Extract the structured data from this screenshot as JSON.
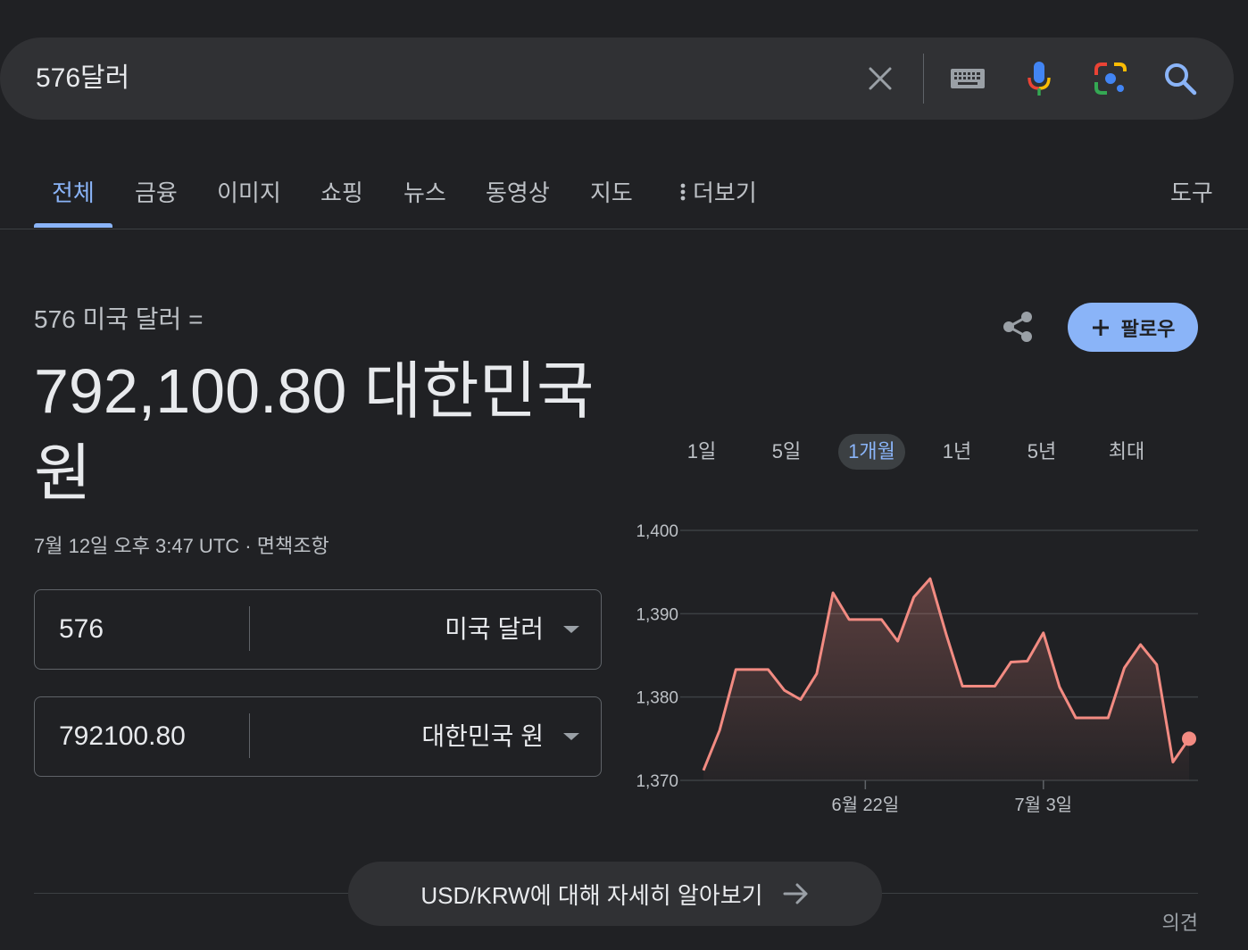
{
  "search": {
    "query": "576달러"
  },
  "icons": {
    "clear": "close-icon",
    "keyboard": "keyboard-icon",
    "mic": "microphone-icon",
    "lens": "google-lens-icon",
    "search": "search-icon",
    "share": "share-icon",
    "more": "more-vert-icon",
    "arrow": "arrow-right-icon"
  },
  "tabs": [
    {
      "label": "전체",
      "active": true
    },
    {
      "label": "금융"
    },
    {
      "label": "이미지"
    },
    {
      "label": "쇼핑"
    },
    {
      "label": "뉴스"
    },
    {
      "label": "동영상"
    },
    {
      "label": "지도"
    },
    {
      "label": "더보기"
    }
  ],
  "tools_label": "도구",
  "result": {
    "from_label": "576 미국 달러 =",
    "amount": "792,100.80 대한민국",
    "amount_unit": "원",
    "timestamp": "7월 12일 오후 3:47 UTC",
    "separator": "·",
    "disclaimer": "면책조항"
  },
  "converter": {
    "from": {
      "value": "576",
      "currency": "미국 달러"
    },
    "to": {
      "value": "792100.80",
      "currency": "대한민국 원"
    }
  },
  "follow_label": "팔로우",
  "ranges": [
    {
      "label": "1일"
    },
    {
      "label": "5일"
    },
    {
      "label": "1개월",
      "active": true
    },
    {
      "label": "1년"
    },
    {
      "label": "5년"
    },
    {
      "label": "최대"
    }
  ],
  "colors": {
    "accent": "#8ab4f8",
    "line": "#f28b82",
    "background": "#202124"
  },
  "chart_data": {
    "type": "area",
    "ylim": [
      1370,
      1400
    ],
    "yticks": [
      "1,400",
      "1,390",
      "1,380",
      "1,370"
    ],
    "ytick_values": [
      1400,
      1390,
      1380,
      1370
    ],
    "xtick_labels": [
      {
        "label": "6월 22일",
        "index": 10
      },
      {
        "label": "7월 3일",
        "index": 21
      }
    ],
    "grid": true,
    "values": [
      1371.2,
      1376.0,
      1383.3,
      1383.3,
      1383.3,
      1380.8,
      1379.7,
      1382.8,
      1392.5,
      1389.3,
      1389.3,
      1389.3,
      1386.7,
      1392.0,
      1394.2,
      1387.5,
      1381.3,
      1381.3,
      1381.3,
      1384.2,
      1384.3,
      1387.7,
      1381.2,
      1377.5,
      1377.5,
      1377.5,
      1383.5,
      1386.3,
      1383.9,
      1372.2,
      1375.0
    ]
  },
  "learn_more_label": "USD/KRW에 대해 자세히 알아보기",
  "feedback_label": "의견"
}
